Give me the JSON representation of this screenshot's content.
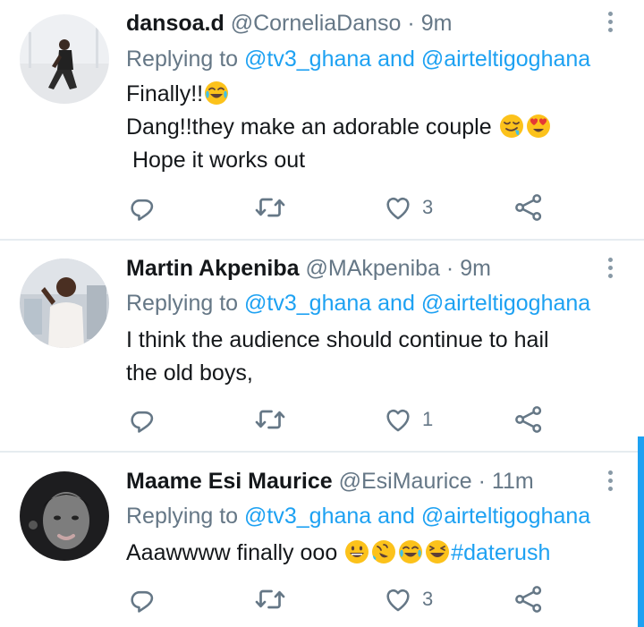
{
  "tweets": [
    {
      "display_name": "dansoa.d",
      "handle": "@CorneliaDanso",
      "separator": "·",
      "time": "9m",
      "replying_prefix": "Replying to",
      "reply_to_1": "@tv3_ghana",
      "reply_and": "and",
      "reply_to_2": "@airteltigoghana",
      "line1": "Finally!!",
      "line2": "Dang!!they make an adorable couple",
      "line3": " Hope it works out",
      "like_count": "3"
    },
    {
      "display_name": "Martin Akpeniba",
      "handle": "@MAkpeniba",
      "separator": "·",
      "time": "9m",
      "replying_prefix": "Replying to",
      "reply_to_1": "@tv3_ghana",
      "reply_and": "and",
      "reply_to_2": "@airteltigoghana",
      "line1": "I think the audience should continue to hail",
      "line2": "the old boys,",
      "like_count": "1"
    },
    {
      "display_name": "Maame Esi Maurice",
      "handle": "@EsiMaurice",
      "separator": "·",
      "time": "11m",
      "replying_prefix": "Replying to",
      "reply_to_1": "@tv3_ghana",
      "reply_and": "and",
      "reply_to_2": "@airteltigoghana",
      "line1": "Aaawwww finally ooo",
      "hashtag": "#daterush",
      "like_count": "3"
    }
  ],
  "icons": {
    "reply": "reply-icon",
    "retweet": "retweet-icon",
    "like": "heart-icon",
    "share": "share-icon",
    "more": "more-vertical-icon"
  },
  "colors": {
    "link": "#1da1f2",
    "secondary_text": "#657786",
    "icon": "#657786",
    "divider": "#e6ecf0"
  }
}
